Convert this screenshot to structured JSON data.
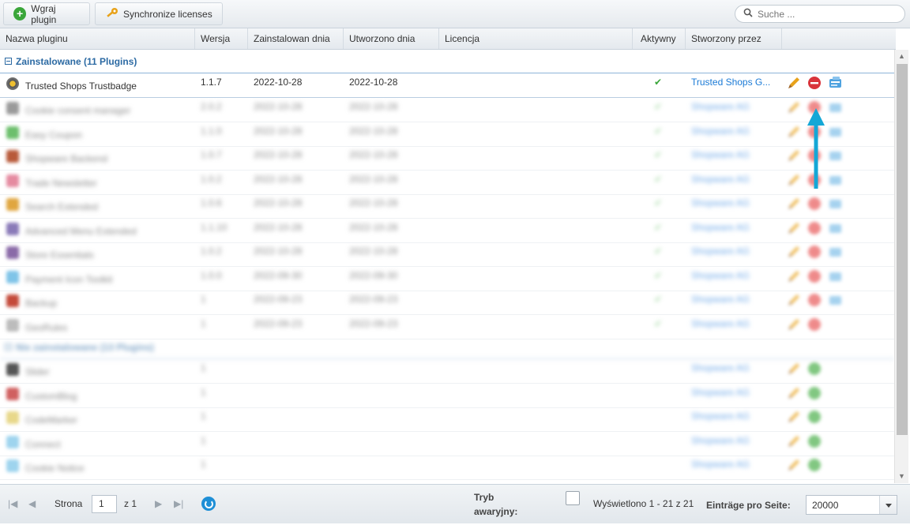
{
  "toolbar": {
    "upload_label": "Wgraj plugin",
    "sync_label": "Synchronize licenses",
    "search_placeholder": "Suche ..."
  },
  "columns": [
    "Nazwa pluginu",
    "Wersja",
    "Zainstalowan dnia",
    "Utworzono dnia",
    "Licencja",
    "Aktywny",
    "Stworzony przez"
  ],
  "groups": [
    {
      "label": "Zainstalowane (11 Plugins)"
    },
    {
      "label": "Nie zainstalowane (13 Plugins)"
    }
  ],
  "selected_plugin": {
    "name": "Trusted Shops Trustbadge",
    "version": "1.1.7",
    "installed": "2022-10-28",
    "created": "2022-10-28",
    "license": "",
    "active": "✔",
    "author": "Trusted Shops G..."
  },
  "installed_blurred_rows": [
    {
      "name": "Cookie consent manager",
      "version": "2.0.2",
      "installed": "2022-10-28",
      "created": "2022-10-28",
      "author": "Shopware AG",
      "icon_color": "#9a9a9a"
    },
    {
      "name": "Easy Coupon",
      "version": "1.1.0",
      "installed": "2022-10-28",
      "created": "2022-10-28",
      "author": "Shopware AG",
      "icon_color": "#6cbf6c"
    },
    {
      "name": "Shopware Backend",
      "version": "1.0.7",
      "installed": "2022-10-28",
      "created": "2022-10-28",
      "author": "Shopware AG",
      "icon_color": "#b85a3a"
    },
    {
      "name": "Trade Newsletter",
      "version": "1.0.2",
      "installed": "2022-10-28",
      "created": "2022-10-28",
      "author": "Shopware AG",
      "icon_color": "#e58aa0"
    },
    {
      "name": "Search Extended",
      "version": "1.0.6",
      "installed": "2022-10-28",
      "created": "2022-10-28",
      "author": "Shopware AG",
      "icon_color": "#e0a640"
    },
    {
      "name": "Advanced Menu Extended",
      "version": "1.1.10",
      "installed": "2022-10-28",
      "created": "2022-10-28",
      "author": "Shopware AG",
      "icon_color": "#8a7ab8"
    },
    {
      "name": "Store Essentials",
      "version": "1.0.2",
      "installed": "2022-10-28",
      "created": "2022-10-28",
      "author": "Shopware AG",
      "icon_color": "#8a6aa8"
    },
    {
      "name": "Payment Icon Toolkit",
      "version": "1.0.0",
      "installed": "2022-09-30",
      "created": "2022-09-30",
      "author": "Shopware AG",
      "icon_color": "#7fc4e8"
    },
    {
      "name": "Backup",
      "version": "1",
      "installed": "2022-09-23",
      "created": "2022-09-23",
      "author": "Shopware AG",
      "icon_color": "#c44a3a"
    },
    {
      "name": "GeoRules",
      "version": "1",
      "installed": "2022-09-23",
      "created": "2022-09-23",
      "author": "Shopware AG",
      "icon_color": "#bcbcbc"
    }
  ],
  "uninstalled_blurred_rows": [
    {
      "name": "Slider",
      "version": "1",
      "author": "Shopware AG",
      "icon_color": "#555555"
    },
    {
      "name": "CustomBlog",
      "version": "1",
      "author": "Shopware AG",
      "icon_color": "#d06060"
    },
    {
      "name": "CodeMarker",
      "version": "1",
      "author": "Shopware AG",
      "icon_color": "#e8d88a"
    },
    {
      "name": "Connect",
      "version": "1",
      "author": "Shopware AG",
      "icon_color": "#9ed4ee"
    },
    {
      "name": "Cookie Notice",
      "version": "1",
      "author": "Shopware AG",
      "icon_color": "#9ed4ee"
    }
  ],
  "pager": {
    "page_label": "Strona",
    "page_value": "1",
    "of_label": "z 1",
    "emergency_label_1": "Tryb",
    "emergency_label_2": "awaryjny:",
    "displayed": "Wyświetlono 1 - 21 z 21",
    "per_page_label": "Einträge pro Seite:",
    "per_page_value": "20000"
  },
  "colors": {
    "group_text": "#2c6aa3",
    "link": "#1a7ad6",
    "active_check": "#3aa63a",
    "delete_red": "#d9343b",
    "annotation_arrow": "#14a7d6"
  }
}
